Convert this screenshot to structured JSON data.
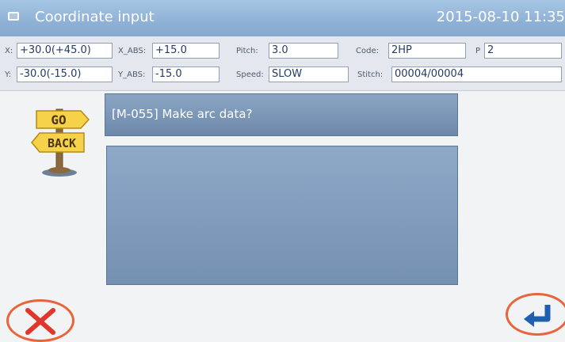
{
  "window": {
    "title": "Coordinate input",
    "datetime": "2015-08-10 11:35",
    "app_icon": "window-icon"
  },
  "info": {
    "x_label": "X:",
    "x_value": "+30.0(+45.0)",
    "x_abs_label": "X_ABS:",
    "x_abs_value": "+15.0",
    "pitch_label": "Pitch:",
    "pitch_value": "3.0",
    "code_label": "Code:",
    "code_value": "2HP",
    "p_label": "P",
    "p_value": "2",
    "y_label": "Y:",
    "y_value": "-30.0(-15.0)",
    "y_abs_label": "Y_ABS:",
    "y_abs_value": "-15.0",
    "speed_label": "Speed:",
    "speed_value": "SLOW",
    "stitch_label": "Stitch:",
    "stitch_value": "00004/00004"
  },
  "sign": {
    "go": "GO",
    "back": "BACK",
    "icon": "go-back-signpost-icon"
  },
  "dialog": {
    "message": "[M-055] Make arc data?"
  },
  "buttons": {
    "cancel_icon": "close-x-icon",
    "enter_icon": "enter-return-icon"
  },
  "colors": {
    "titlebar": "#8fb1d6",
    "message_panel": "#7c98b8",
    "cancel_red": "#e0362c",
    "enter_blue": "#1f5fae",
    "highlight_ring": "#e8643a"
  }
}
